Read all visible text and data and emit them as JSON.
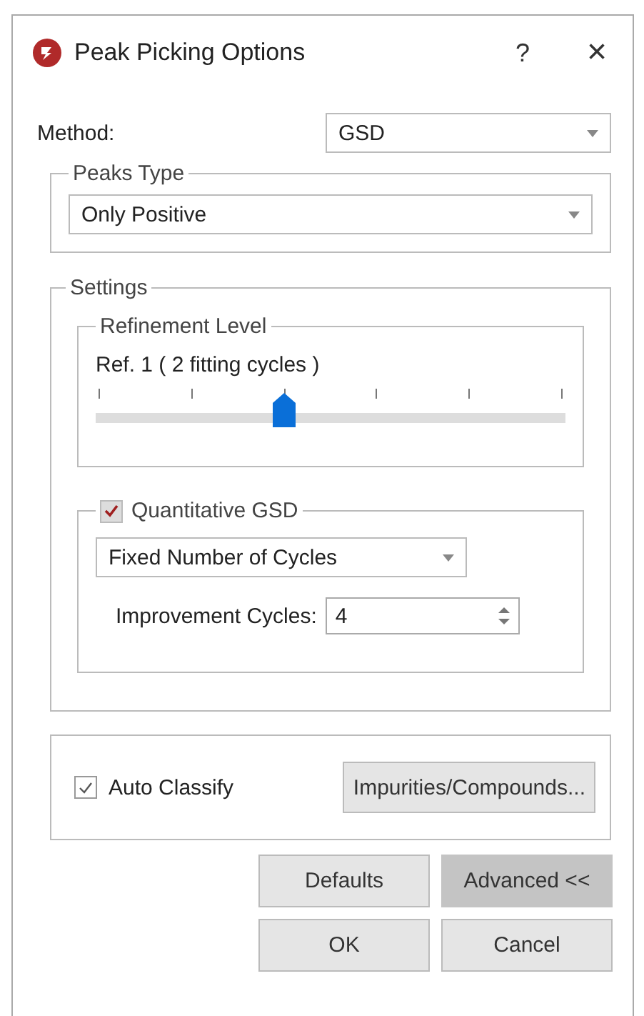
{
  "window": {
    "title": "Peak Picking Options",
    "help": "?",
    "close": "×"
  },
  "method": {
    "label": "Method:",
    "value": "GSD"
  },
  "peaks_type": {
    "title": "Peaks Type",
    "value": "Only Positive"
  },
  "settings": {
    "title": "Settings",
    "refinement": {
      "title": "Refinement Level",
      "reading": "Ref. 1 ( 2 fitting cycles )",
      "level": 0.4
    },
    "quantitative": {
      "title": "Quantitative GSD",
      "checked": true,
      "mode": "Fixed Number of Cycles",
      "cycles_label": "Improvement Cycles:",
      "cycles_value": "4"
    }
  },
  "auto_classify": {
    "label": "Auto Classify",
    "checked": true,
    "button": "Impurities/Compounds..."
  },
  "buttons": [
    {
      "label": "Defaults",
      "pressed": false
    },
    {
      "label": "Advanced <<",
      "pressed": true
    },
    {
      "label": "OK",
      "pressed": false
    },
    {
      "label": "Cancel",
      "pressed": false
    }
  ]
}
